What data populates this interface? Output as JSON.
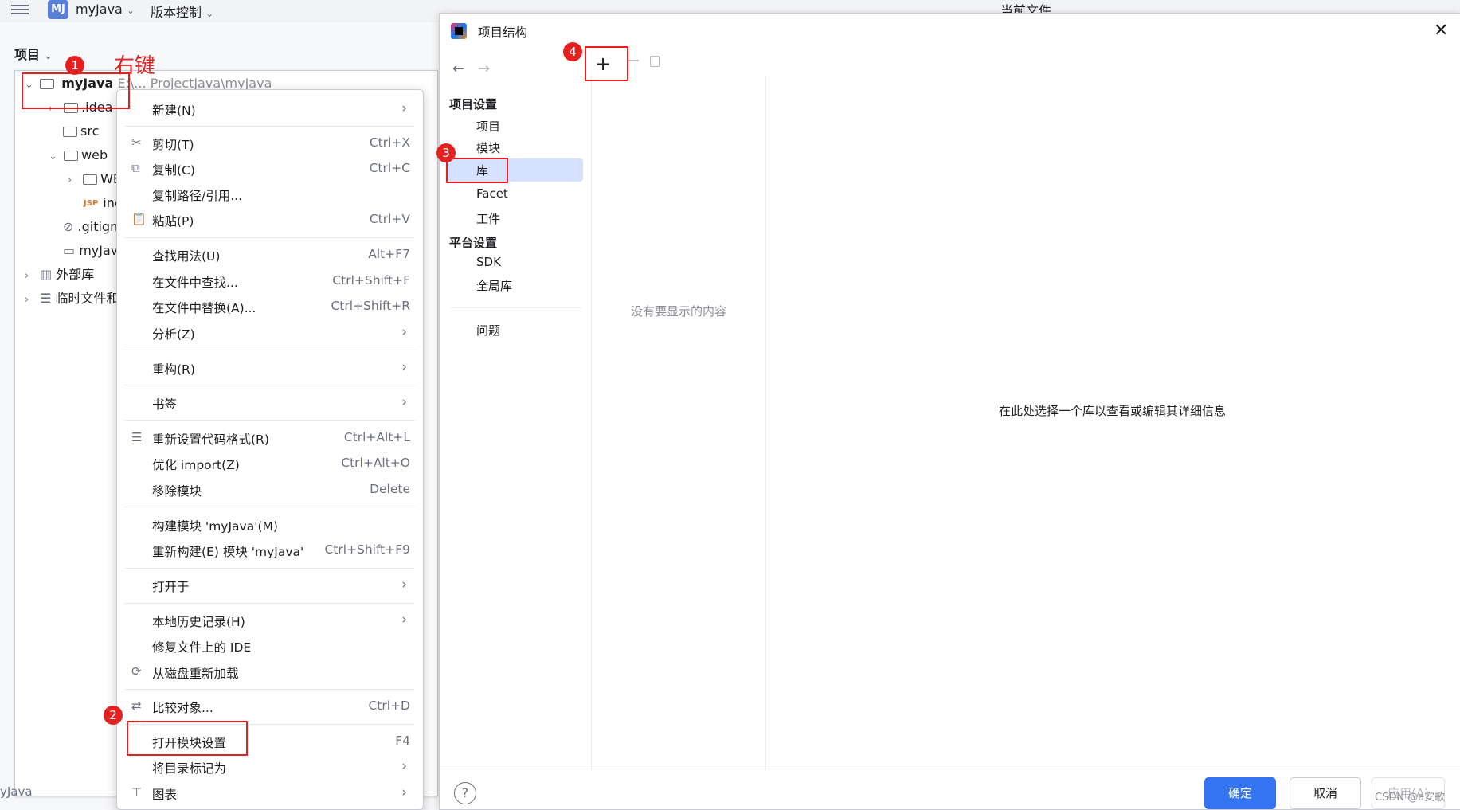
{
  "topbar": {
    "project": "myJava",
    "vcs": "版本控制",
    "current_file": "当前文件"
  },
  "project_panel": {
    "title": "项目",
    "root": {
      "name": "myJava",
      "hint": "E:\\... ProjectJava\\myJava"
    },
    "items": [
      ".idea",
      "src",
      "web",
      "WEB-INF",
      "index.jsp",
      ".gitignore",
      "myJava.iml"
    ],
    "external_libs": "外部库",
    "scratch": "临时文件和控制台",
    "bottom_text": "yJava"
  },
  "context_menu": {
    "items": [
      {
        "label": "新建(N)"
      },
      {
        "label": "剪切(T)",
        "shortcut": "Ctrl+X"
      },
      {
        "label": "复制(C)",
        "shortcut": "Ctrl+C"
      },
      {
        "label": "复制路径/引用..."
      },
      {
        "label": "粘贴(P)",
        "shortcut": "Ctrl+V"
      },
      {
        "label": "查找用法(U)",
        "shortcut": "Alt+F7"
      },
      {
        "label": "在文件中查找...",
        "shortcut": "Ctrl+Shift+F"
      },
      {
        "label": "在文件中替换(A)...",
        "shortcut": "Ctrl+Shift+R"
      },
      {
        "label": "分析(Z)"
      },
      {
        "label": "重构(R)"
      },
      {
        "label": "书签"
      },
      {
        "label": "重新设置代码格式(R)",
        "shortcut": "Ctrl+Alt+L"
      },
      {
        "label": "优化 import(Z)",
        "shortcut": "Ctrl+Alt+O"
      },
      {
        "label": "移除模块",
        "shortcut": "Delete"
      },
      {
        "label": "构建模块 'myJava'(M)"
      },
      {
        "label": "重新构建(E) 模块 'myJava'",
        "shortcut": "Ctrl+Shift+F9"
      },
      {
        "label": "打开于"
      },
      {
        "label": "本地历史记录(H)"
      },
      {
        "label": "修复文件上的 IDE"
      },
      {
        "label": "从磁盘重新加载"
      },
      {
        "label": "比较对象...",
        "shortcut": "Ctrl+D"
      },
      {
        "label": "打开模块设置",
        "shortcut": "F4"
      },
      {
        "label": "将目录标记为"
      },
      {
        "label": "图表"
      }
    ]
  },
  "dialog": {
    "title": "项目结构",
    "section_project": "项目设置",
    "project_items": [
      "项目",
      "模块",
      "库",
      "Facet",
      "工件"
    ],
    "section_platform": "平台设置",
    "platform_items": [
      "SDK",
      "全局库"
    ],
    "problems": "问题",
    "empty_middle": "没有要显示的内容",
    "empty_right": "在此处选择一个库以查看或编辑其详细信息",
    "ok": "确定",
    "cancel": "取消",
    "apply": "应用(A)",
    "help": "?"
  },
  "annotations": {
    "right_click": "右键",
    "b1": "1",
    "b2": "2",
    "b3": "3",
    "b4": "4",
    "color": "#e5201f"
  },
  "watermark": "CSDN @a安歌"
}
